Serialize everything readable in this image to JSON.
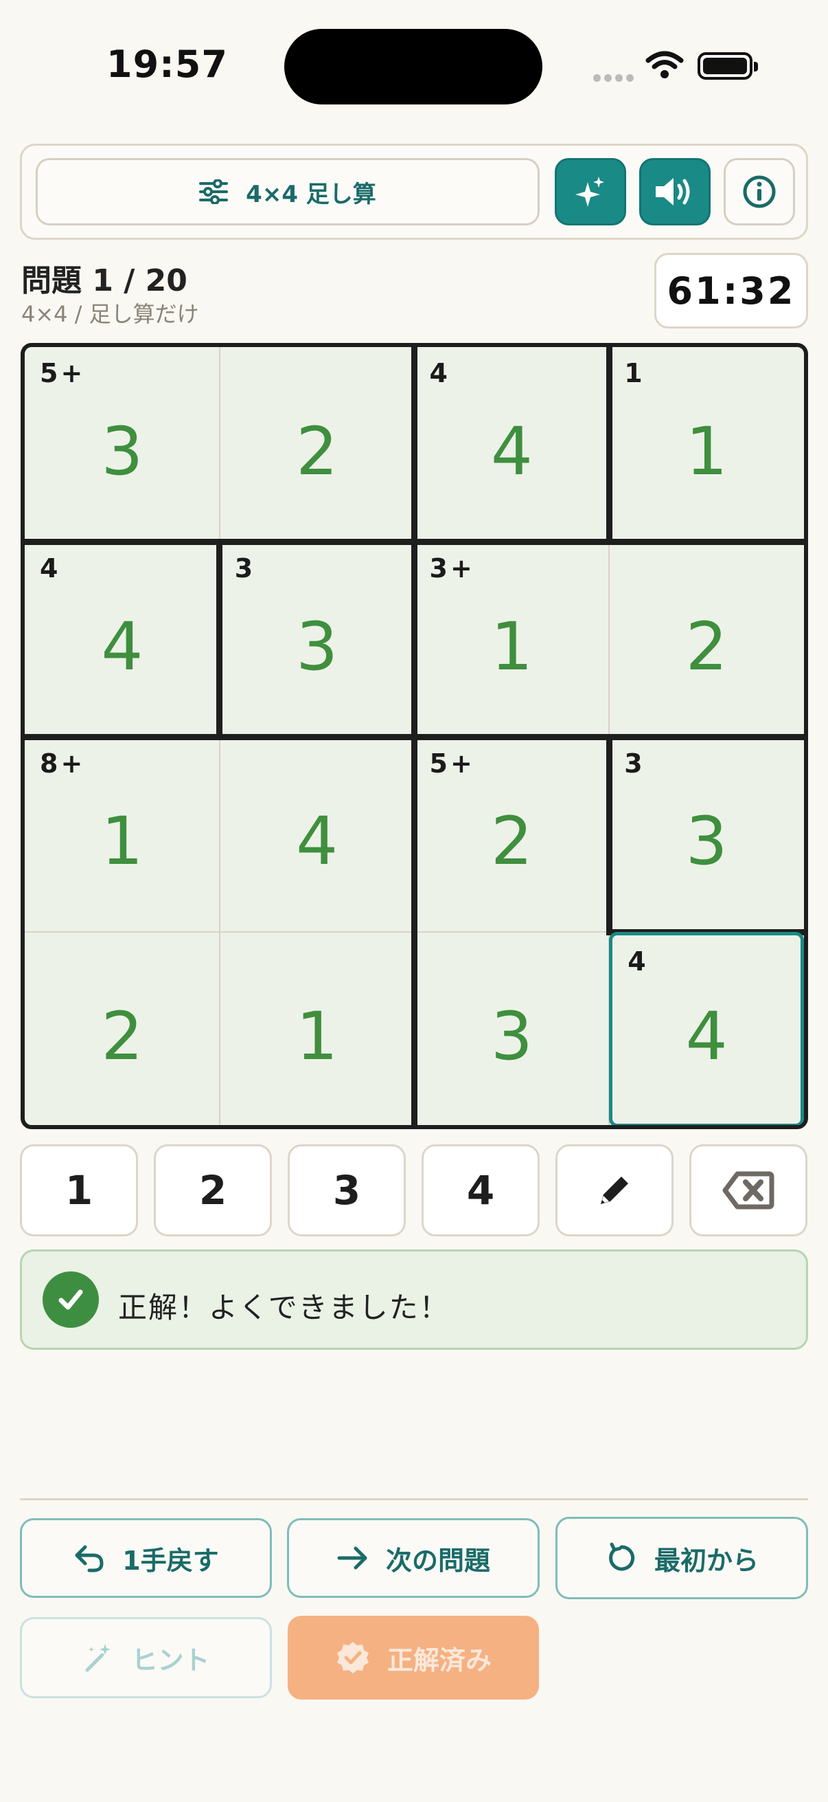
{
  "status_bar": {
    "time": "19:57"
  },
  "toolbar": {
    "mode_label": "4×4 足し算"
  },
  "header": {
    "problem": "問題 1 / 20",
    "subtitle": "4×4 / 足し算だけ",
    "timer": "61:32"
  },
  "board": {
    "cells": [
      {
        "clue": "5+",
        "value": "3"
      },
      {
        "clue": "",
        "value": "2"
      },
      {
        "clue": "4",
        "value": "4"
      },
      {
        "clue": "1",
        "value": "1"
      },
      {
        "clue": "4",
        "value": "4"
      },
      {
        "clue": "3",
        "value": "3"
      },
      {
        "clue": "3+",
        "value": "1"
      },
      {
        "clue": "",
        "value": "2"
      },
      {
        "clue": "8+",
        "value": "1"
      },
      {
        "clue": "",
        "value": "4"
      },
      {
        "clue": "5+",
        "value": "2"
      },
      {
        "clue": "3",
        "value": "3"
      },
      {
        "clue": "",
        "value": "2"
      },
      {
        "clue": "",
        "value": "1"
      },
      {
        "clue": "",
        "value": "3"
      },
      {
        "clue": "4",
        "value": "4"
      }
    ],
    "selected_index": 15
  },
  "numpad": {
    "keys": [
      "1",
      "2",
      "3",
      "4"
    ]
  },
  "feedback": {
    "message": "正解！よくできました！"
  },
  "actions": {
    "undo": "1手戻す",
    "next": "次の問題",
    "restart": "最初から",
    "hint": "ヒント",
    "solved": "正解済み"
  },
  "colors": {
    "accent": "#1a8a86",
    "value_green": "#3f8f3e",
    "success_orange": "#f5b182"
  }
}
